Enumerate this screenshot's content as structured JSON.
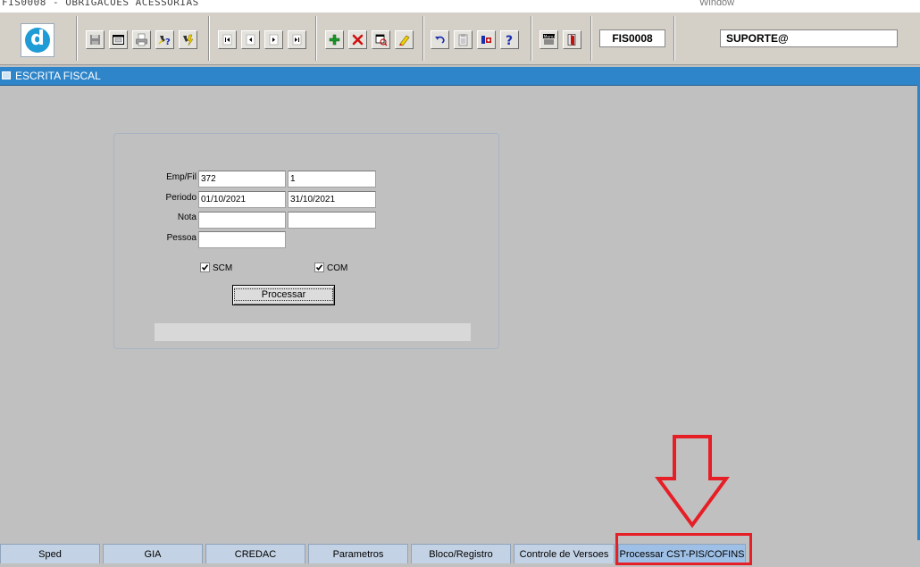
{
  "window": {
    "title": "FIS0008 - OBRIGACOES ACESSORIAS",
    "menu_window": "Window"
  },
  "toolbar": {
    "program_code": "FIS0008",
    "user": "SUPORTE@",
    "logo_letter": "d",
    "buttons": [
      {
        "icon": "save-icon"
      },
      {
        "icon": "window-icon"
      },
      {
        "icon": "print-icon"
      },
      {
        "icon": "query-help-icon"
      },
      {
        "icon": "execute-query-icon"
      },
      {
        "icon": "first-record-icon"
      },
      {
        "icon": "previous-record-icon"
      },
      {
        "icon": "next-record-icon"
      },
      {
        "icon": "last-record-icon"
      },
      {
        "icon": "insert-record-icon"
      },
      {
        "icon": "delete-record-icon"
      },
      {
        "icon": "duplicate-record-icon"
      },
      {
        "icon": "clear-record-icon"
      },
      {
        "icon": "undo-icon"
      },
      {
        "icon": "clipboard-icon"
      },
      {
        "icon": "tools-icon"
      },
      {
        "icon": "help-icon"
      },
      {
        "icon": "menu-icon"
      },
      {
        "icon": "exit-icon"
      }
    ],
    "menu_icon_text": "Menu"
  },
  "section": {
    "title": "ESCRITA FISCAL"
  },
  "form": {
    "labels": {
      "emp_fil": "Emp/Fil",
      "periodo": "Periodo",
      "nota": "Nota",
      "pessoa": "Pessoa"
    },
    "values": {
      "empresa": "372",
      "filial": "1",
      "periodo_inicio": "01/10/2021",
      "periodo_fim": "31/10/2021",
      "nota_inicio": "",
      "nota_fim": "",
      "pessoa": ""
    },
    "checkboxes": {
      "scm": {
        "label": "SCM",
        "checked": true
      },
      "com": {
        "label": "COM",
        "checked": true
      }
    },
    "process_button": "Processar"
  },
  "tabs": [
    {
      "label": "Sped"
    },
    {
      "label": "GIA"
    },
    {
      "label": "CREDAC"
    },
    {
      "label": "Parametros"
    },
    {
      "label": "Bloco/Registro"
    },
    {
      "label": "Controle de Versoes"
    },
    {
      "label": "Processar CST-PIS/COFINS",
      "active": true
    }
  ],
  "colors": {
    "header": "#2f85c9",
    "annotation": "#e61e25",
    "background": "#c0c0c0"
  }
}
